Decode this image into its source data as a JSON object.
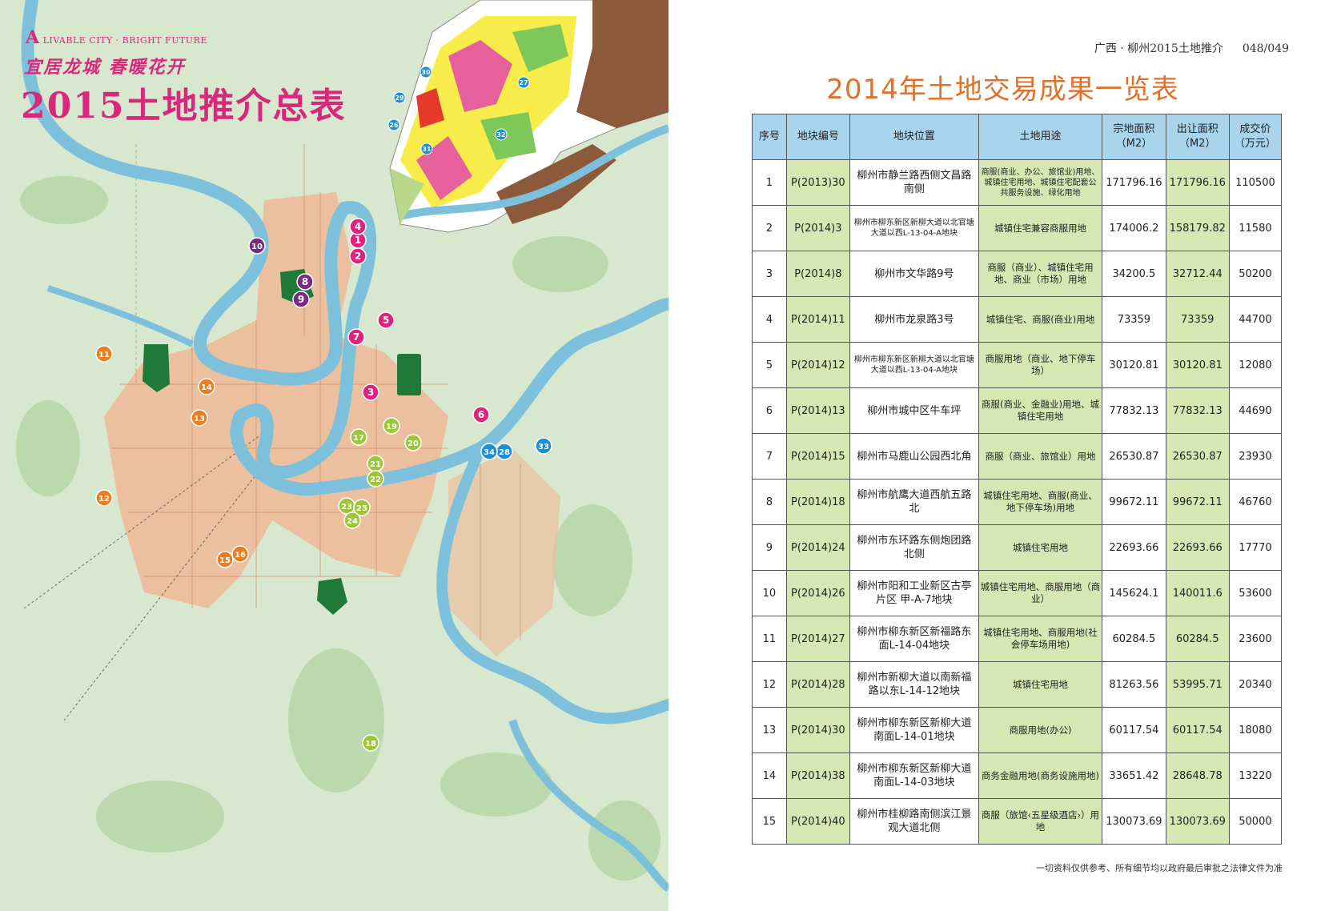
{
  "map": {
    "logo_small": "LIVABLE CITY · BRIGHT FUTURE",
    "slogan": "宜居龙城 春暖花开",
    "title": "2015土地推介总表",
    "markers": [
      {
        "label": "1",
        "group": "magenta"
      },
      {
        "label": "2",
        "group": "magenta"
      },
      {
        "label": "3",
        "group": "magenta"
      },
      {
        "label": "4",
        "group": "magenta"
      },
      {
        "label": "5",
        "group": "magenta"
      },
      {
        "label": "6",
        "group": "magenta"
      },
      {
        "label": "7",
        "group": "magenta"
      },
      {
        "label": "8",
        "group": "purple"
      },
      {
        "label": "9",
        "group": "purple"
      },
      {
        "label": "10",
        "group": "purple"
      },
      {
        "label": "11",
        "group": "orange"
      },
      {
        "label": "12",
        "group": "orange"
      },
      {
        "label": "13",
        "group": "orange"
      },
      {
        "label": "14",
        "group": "orange"
      },
      {
        "label": "15",
        "group": "orange"
      },
      {
        "label": "16",
        "group": "orange"
      },
      {
        "label": "17",
        "group": "lime"
      },
      {
        "label": "18",
        "group": "lime"
      },
      {
        "label": "19",
        "group": "lime"
      },
      {
        "label": "20",
        "group": "lime"
      },
      {
        "label": "21",
        "group": "lime"
      },
      {
        "label": "22",
        "group": "lime"
      },
      {
        "label": "23",
        "group": "lime"
      },
      {
        "label": "24",
        "group": "lime"
      },
      {
        "label": "25",
        "group": "lime"
      },
      {
        "label": "28",
        "group": "blue"
      },
      {
        "label": "33",
        "group": "blue"
      },
      {
        "label": "34",
        "group": "blue"
      }
    ],
    "inset_markers": [
      "26",
      "27",
      "29",
      "30",
      "31",
      "32"
    ],
    "colors": {
      "magenta": "#e0227e",
      "purple": "#7b2a83",
      "orange": "#ea7c22",
      "lime": "#9cc53a",
      "blue": "#1a8fd3",
      "river": "#7cc0dc",
      "urban": "#f0b896",
      "park": "#1f7a3a"
    }
  },
  "header": {
    "left": "广西 · 柳州2015土地推介",
    "right": "048/049"
  },
  "title": "2014年土地交易成果一览表",
  "table": {
    "columns": [
      "序号",
      "地块编号",
      "地块位置",
      "土地用途",
      "宗地面积（M2）",
      "出让面积（M2）",
      "成交价（万元）"
    ],
    "rows": [
      {
        "no": "1",
        "code": "P(2013)30",
        "location": "柳州市静兰路西侧文昌路南侧",
        "use": "商服(商业、办公、旅馆业)用地、城镇住宅用地、城镇住宅配套公共服务设施、绿化用地",
        "area": "171796.16",
        "transfer": "171796.16",
        "price": "110500",
        "loc_size": "",
        "use_size": "sm"
      },
      {
        "no": "2",
        "code": "P(2014)3",
        "location": "柳州市柳东新区新柳大道以北官塘大道以西L-13-04-A地块",
        "use": "城镇住宅兼容商服用地",
        "area": "174006.2",
        "transfer": "158179.82",
        "price": "11580",
        "loc_size": "sm",
        "use_size": "md"
      },
      {
        "no": "3",
        "code": "P(2014)8",
        "location": "柳州市文华路9号",
        "use": "商服（商业）、城镇住宅用地、商业（市场）用地",
        "area": "34200.5",
        "transfer": "32712.44",
        "price": "50200",
        "loc_size": "",
        "use_size": "md"
      },
      {
        "no": "4",
        "code": "P(2014)11",
        "location": "柳州市龙泉路3号",
        "use": "城镇住宅、商服(商业)用地",
        "area": "73359",
        "transfer": "73359",
        "price": "44700",
        "loc_size": "",
        "use_size": "md"
      },
      {
        "no": "5",
        "code": "P(2014)12",
        "location": "柳州市柳东新区新柳大道以北官塘大道以西L-13-04-A地块",
        "use": "商服用地（商业、地下停车场）",
        "area": "30120.81",
        "transfer": "30120.81",
        "price": "12080",
        "loc_size": "sm",
        "use_size": "md"
      },
      {
        "no": "6",
        "code": "P(2014)13",
        "location": "柳州市城中区牛车坪",
        "use": "商服(商业、金融业)用地、城镇住宅用地",
        "area": "77832.13",
        "transfer": "77832.13",
        "price": "44690",
        "loc_size": "",
        "use_size": "md"
      },
      {
        "no": "7",
        "code": "P(2014)15",
        "location": "柳州市马鹿山公园西北角",
        "use": "商服（商业、旅馆业）用地",
        "area": "26530.87",
        "transfer": "26530.87",
        "price": "23930",
        "loc_size": "",
        "use_size": "md"
      },
      {
        "no": "8",
        "code": "P(2014)18",
        "location": "柳州市航鹰大道西航五路北",
        "use": "城镇住宅用地、商服(商业、地下停车场)用地",
        "area": "99672.11",
        "transfer": "99672.11",
        "price": "46760",
        "loc_size": "",
        "use_size": "md"
      },
      {
        "no": "9",
        "code": "P(2014)24",
        "location": "柳州市东环路东侧炮团路北侧",
        "use": "城镇住宅用地",
        "area": "22693.66",
        "transfer": "22693.66",
        "price": "17770",
        "loc_size": "",
        "use_size": "md"
      },
      {
        "no": "10",
        "code": "P(2014)26",
        "location": "柳州市阳和工业新区古亭片区 甲-A-7地块",
        "use": "城镇住宅用地、商服用地（商业）",
        "area": "145624.1",
        "transfer": "140011.6",
        "price": "53600",
        "loc_size": "",
        "use_size": "md"
      },
      {
        "no": "11",
        "code": "P(2014)27",
        "location": "柳州市柳东新区新福路东面L-14-04地块",
        "use": "城镇住宅用地、商服用地(社会停车场用地)",
        "area": "60284.5",
        "transfer": "60284.5",
        "price": "23600",
        "loc_size": "",
        "use_size": "md"
      },
      {
        "no": "12",
        "code": "P(2014)28",
        "location": "柳州市新柳大道以南新福路以东L-14-12地块",
        "use": "城镇住宅用地",
        "area": "81263.56",
        "transfer": "53995.71",
        "price": "20340",
        "loc_size": "",
        "use_size": "md"
      },
      {
        "no": "13",
        "code": "P(2014)30",
        "location": "柳州市柳东新区新柳大道南面L-14-01地块",
        "use": "商服用地(办公)",
        "area": "60117.54",
        "transfer": "60117.54",
        "price": "18080",
        "loc_size": "",
        "use_size": "md"
      },
      {
        "no": "14",
        "code": "P(2014)38",
        "location": "柳州市柳东新区新柳大道南面L-14-03地块",
        "use": "商务金融用地(商务设施用地)",
        "area": "33651.42",
        "transfer": "28648.78",
        "price": "13220",
        "loc_size": "",
        "use_size": "md"
      },
      {
        "no": "15",
        "code": "P(2014)40",
        "location": "柳州市桂柳路南侧滨江景观大道北侧",
        "use": "商服（旅馆‹五星级酒店›）用地",
        "area": "130073.69",
        "transfer": "130073.69",
        "price": "50000",
        "loc_size": "",
        "use_size": "md"
      }
    ]
  },
  "footer": "一切资料仅供参考、所有细节均以政府最后审批之法律文件为准"
}
